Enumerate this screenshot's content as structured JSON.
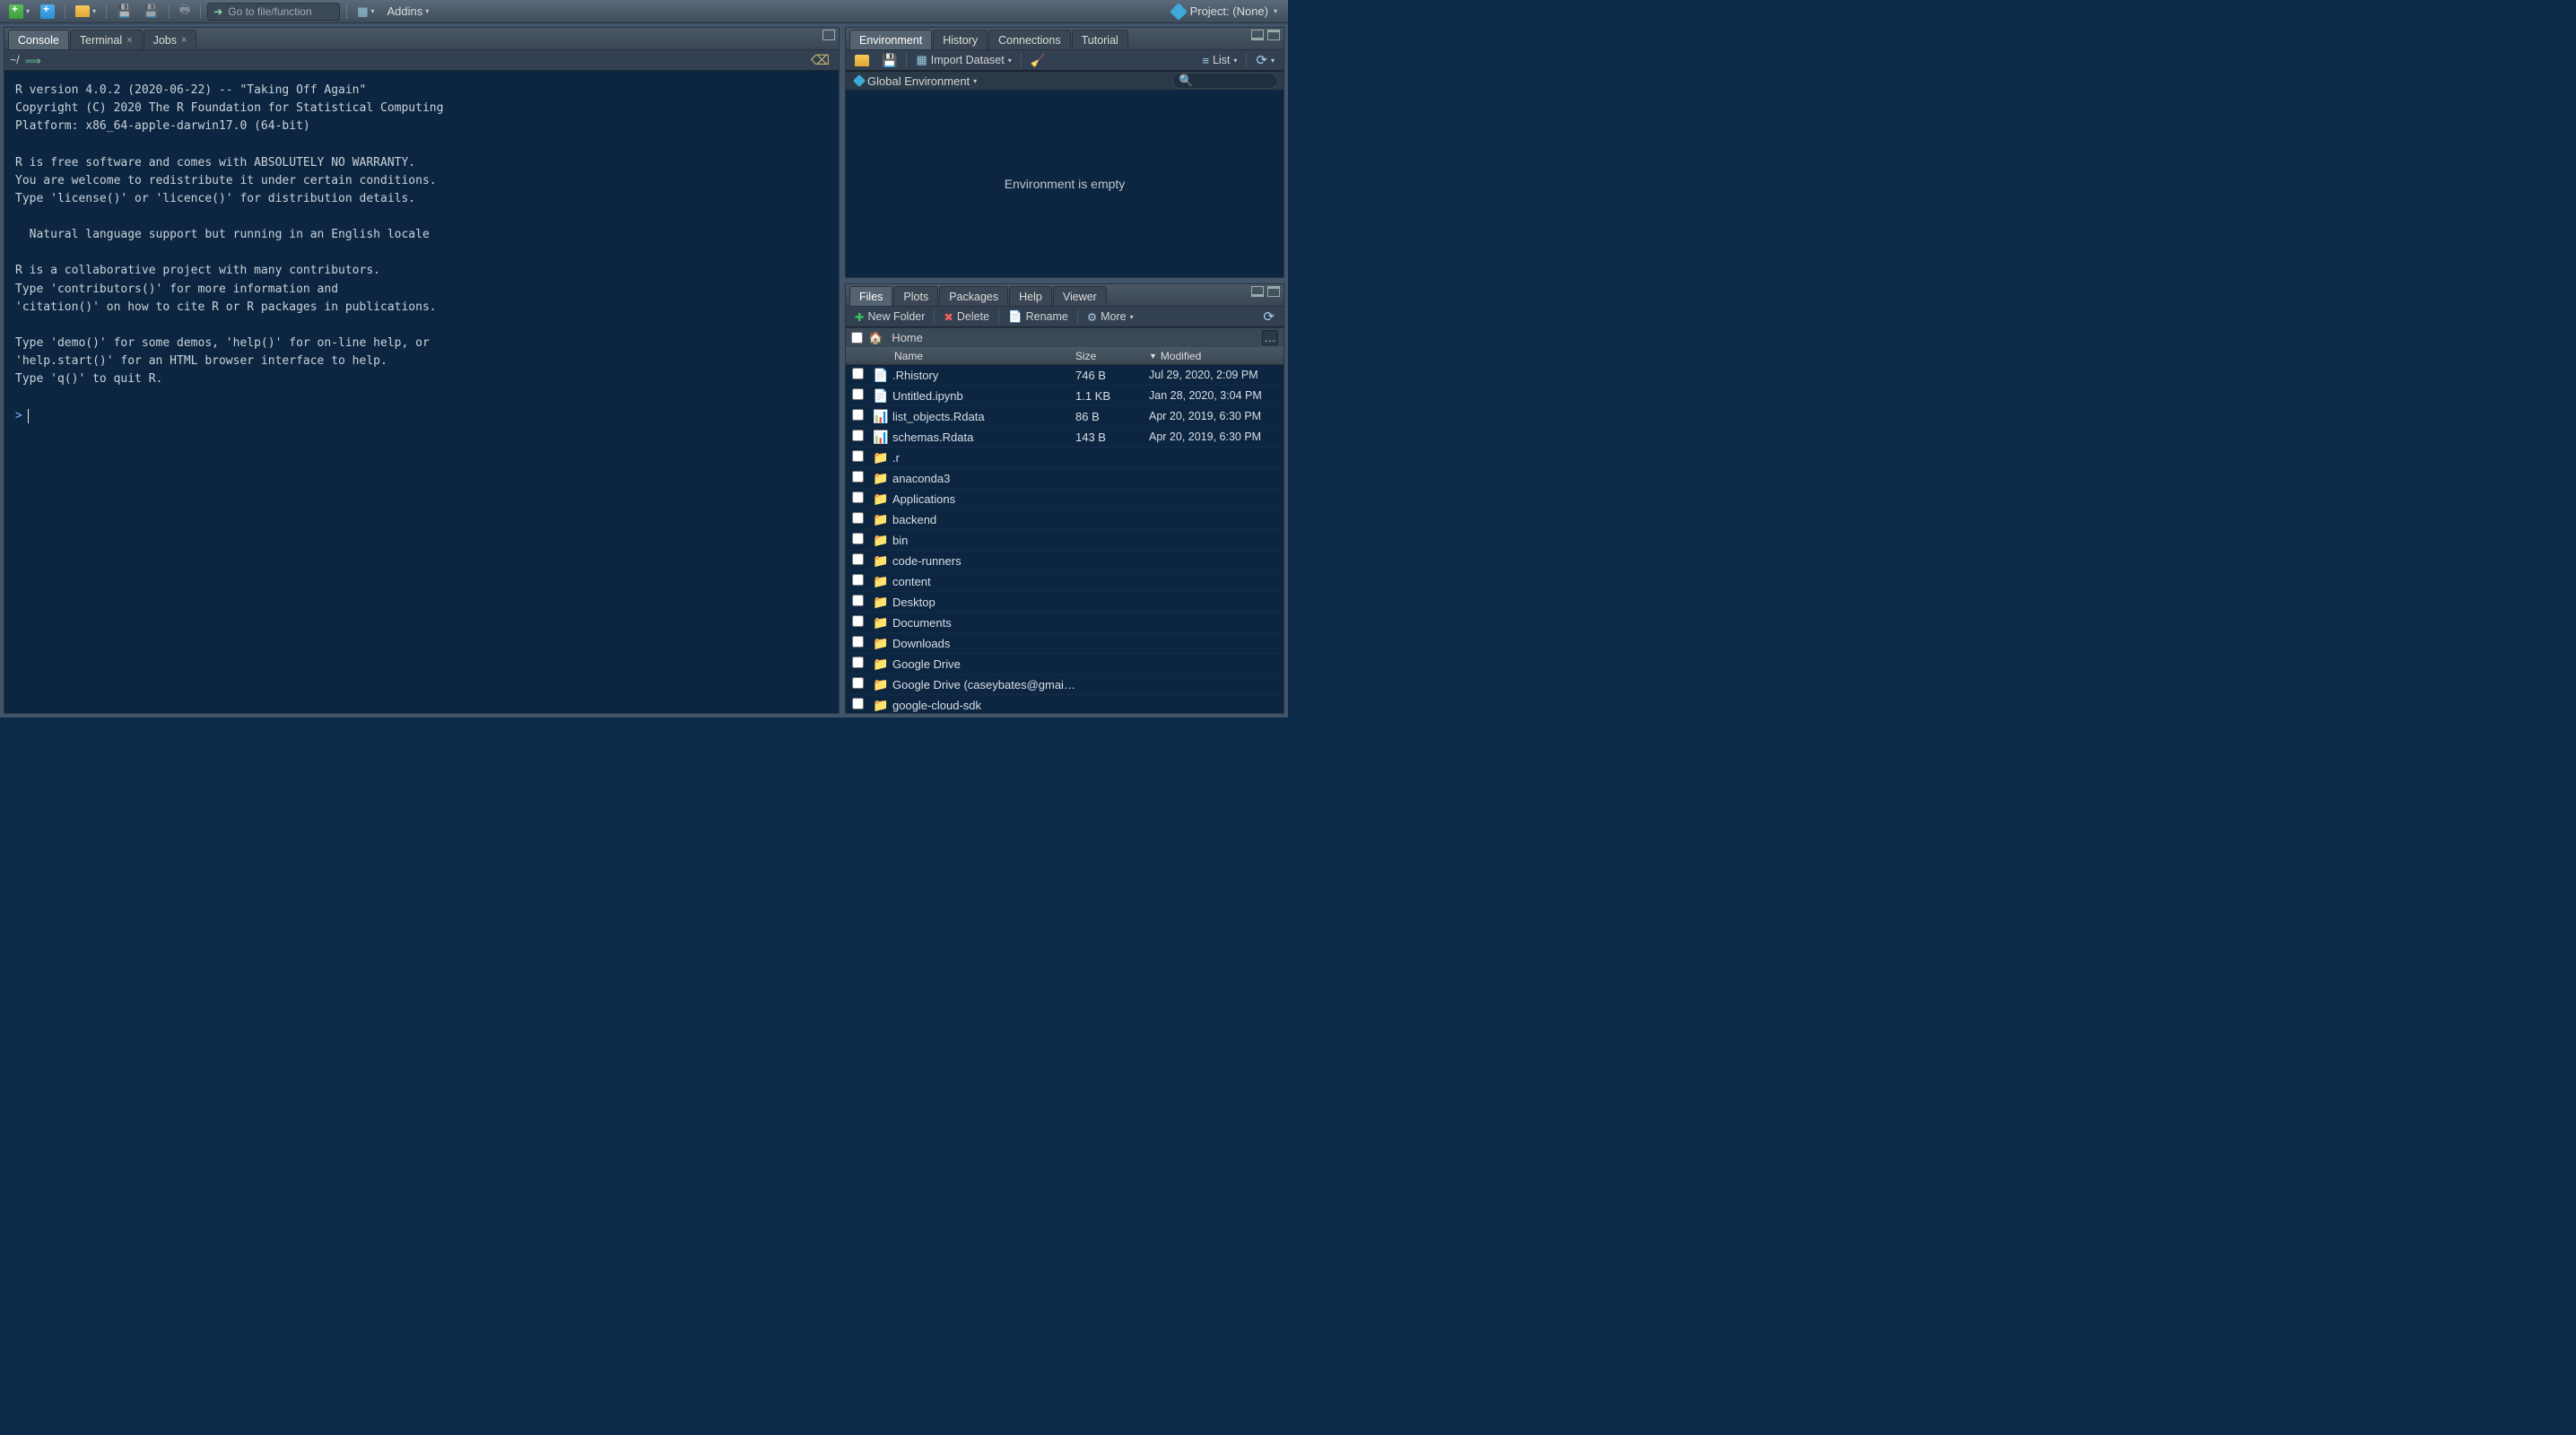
{
  "toolbar": {
    "goto_placeholder": "Go to file/function",
    "addins_label": "Addins",
    "project_label": "Project: (None)"
  },
  "left": {
    "tabs": [
      "Console",
      "Terminal",
      "Jobs"
    ],
    "active_tab": 0,
    "cwd": "~/",
    "console_text": "R version 4.0.2 (2020-06-22) -- \"Taking Off Again\"\nCopyright (C) 2020 The R Foundation for Statistical Computing\nPlatform: x86_64-apple-darwin17.0 (64-bit)\n\nR is free software and comes with ABSOLUTELY NO WARRANTY.\nYou are welcome to redistribute it under certain conditions.\nType 'license()' or 'licence()' for distribution details.\n\n  Natural language support but running in an English locale\n\nR is a collaborative project with many contributors.\nType 'contributors()' for more information and\n'citation()' on how to cite R or R packages in publications.\n\nType 'demo()' for some demos, 'help()' for on-line help, or\n'help.start()' for an HTML browser interface to help.\nType 'q()' to quit R.\n",
    "prompt": ">"
  },
  "env": {
    "tabs": [
      "Environment",
      "History",
      "Connections",
      "Tutorial"
    ],
    "active_tab": 0,
    "import_label": "Import Dataset",
    "list_label": "List",
    "scope_label": "Global Environment",
    "empty_msg": "Environment is empty"
  },
  "files": {
    "tabs": [
      "Files",
      "Plots",
      "Packages",
      "Help",
      "Viewer"
    ],
    "active_tab": 0,
    "newfolder_label": "New Folder",
    "delete_label": "Delete",
    "rename_label": "Rename",
    "more_label": "More",
    "breadcrumb": "Home",
    "cols": {
      "name": "Name",
      "size": "Size",
      "modified": "Modified"
    },
    "rows": [
      {
        "icon": "doc",
        "name": ".Rhistory",
        "size": "746 B",
        "modified": "Jul 29, 2020, 2:09 PM"
      },
      {
        "icon": "file",
        "name": "Untitled.ipynb",
        "size": "1.1 KB",
        "modified": "Jan 28, 2020, 3:04 PM"
      },
      {
        "icon": "rdata",
        "name": "list_objects.Rdata",
        "size": "86 B",
        "modified": "Apr 20, 2019, 6:30 PM"
      },
      {
        "icon": "rdata",
        "name": "schemas.Rdata",
        "size": "143 B",
        "modified": "Apr 20, 2019, 6:30 PM"
      },
      {
        "icon": "folder",
        "name": ".r",
        "size": "",
        "modified": ""
      },
      {
        "icon": "folder",
        "name": "anaconda3",
        "size": "",
        "modified": ""
      },
      {
        "icon": "folder",
        "name": "Applications",
        "size": "",
        "modified": ""
      },
      {
        "icon": "folder",
        "name": "backend",
        "size": "",
        "modified": ""
      },
      {
        "icon": "folder",
        "name": "bin",
        "size": "",
        "modified": ""
      },
      {
        "icon": "folder",
        "name": "code-runners",
        "size": "",
        "modified": ""
      },
      {
        "icon": "folder",
        "name": "content",
        "size": "",
        "modified": ""
      },
      {
        "icon": "folder",
        "name": "Desktop",
        "size": "",
        "modified": ""
      },
      {
        "icon": "folder",
        "name": "Documents",
        "size": "",
        "modified": ""
      },
      {
        "icon": "folder",
        "name": "Downloads",
        "size": "",
        "modified": ""
      },
      {
        "icon": "folder",
        "name": "Google Drive",
        "size": "",
        "modified": ""
      },
      {
        "icon": "folder",
        "name": "Google Drive (caseybates@gmai…",
        "size": "",
        "modified": ""
      },
      {
        "icon": "folder",
        "name": "google-cloud-sdk",
        "size": "",
        "modified": ""
      }
    ]
  }
}
